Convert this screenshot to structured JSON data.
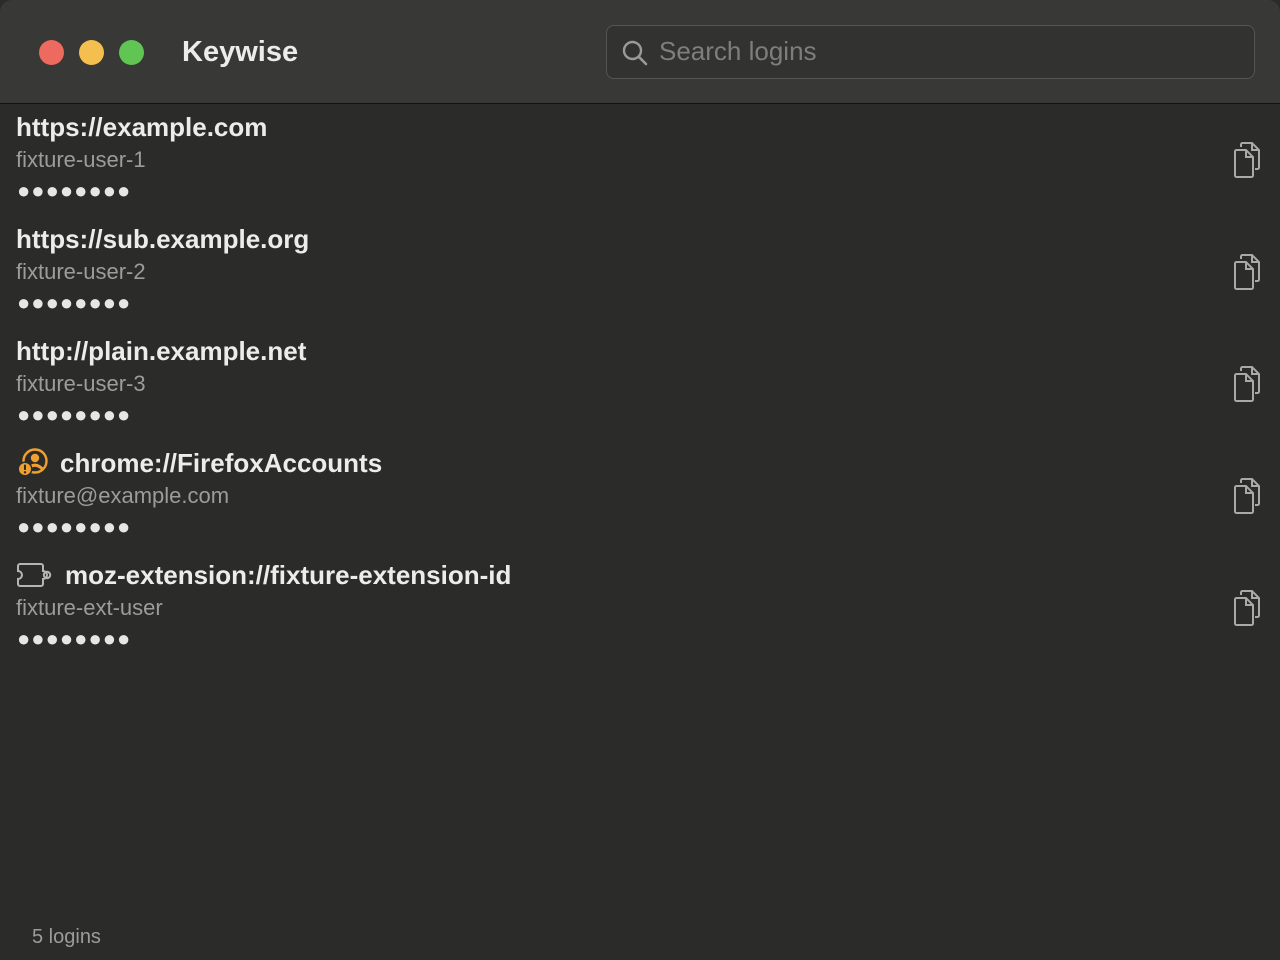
{
  "window": {
    "title": "Keywise"
  },
  "search": {
    "placeholder": "Search logins",
    "value": ""
  },
  "logins": [
    {
      "origin": "https://example.com",
      "username": "fixture-user-1",
      "password_mask": "●●●●●●●●",
      "icon": "none"
    },
    {
      "origin": "https://sub.example.org",
      "username": "fixture-user-2",
      "password_mask": "●●●●●●●●",
      "icon": "none"
    },
    {
      "origin": "http://plain.example.net",
      "username": "fixture-user-3",
      "password_mask": "●●●●●●●●",
      "icon": "none"
    },
    {
      "origin": "chrome://FirefoxAccounts",
      "username": "fixture@example.com",
      "password_mask": "●●●●●●●●",
      "icon": "account-warning-icon"
    },
    {
      "origin": "moz-extension://fixture-extension-id",
      "username": "fixture-ext-user",
      "password_mask": "●●●●●●●●",
      "icon": "extension-icon"
    }
  ],
  "footer": {
    "count_label": "5 logins"
  },
  "colors": {
    "background": "#2b2b2a",
    "titlebar": "#383837",
    "close": "#ec6a5e",
    "minimize": "#f4bf4f",
    "zoom": "#61c554",
    "warning_accent": "#f0a030"
  }
}
